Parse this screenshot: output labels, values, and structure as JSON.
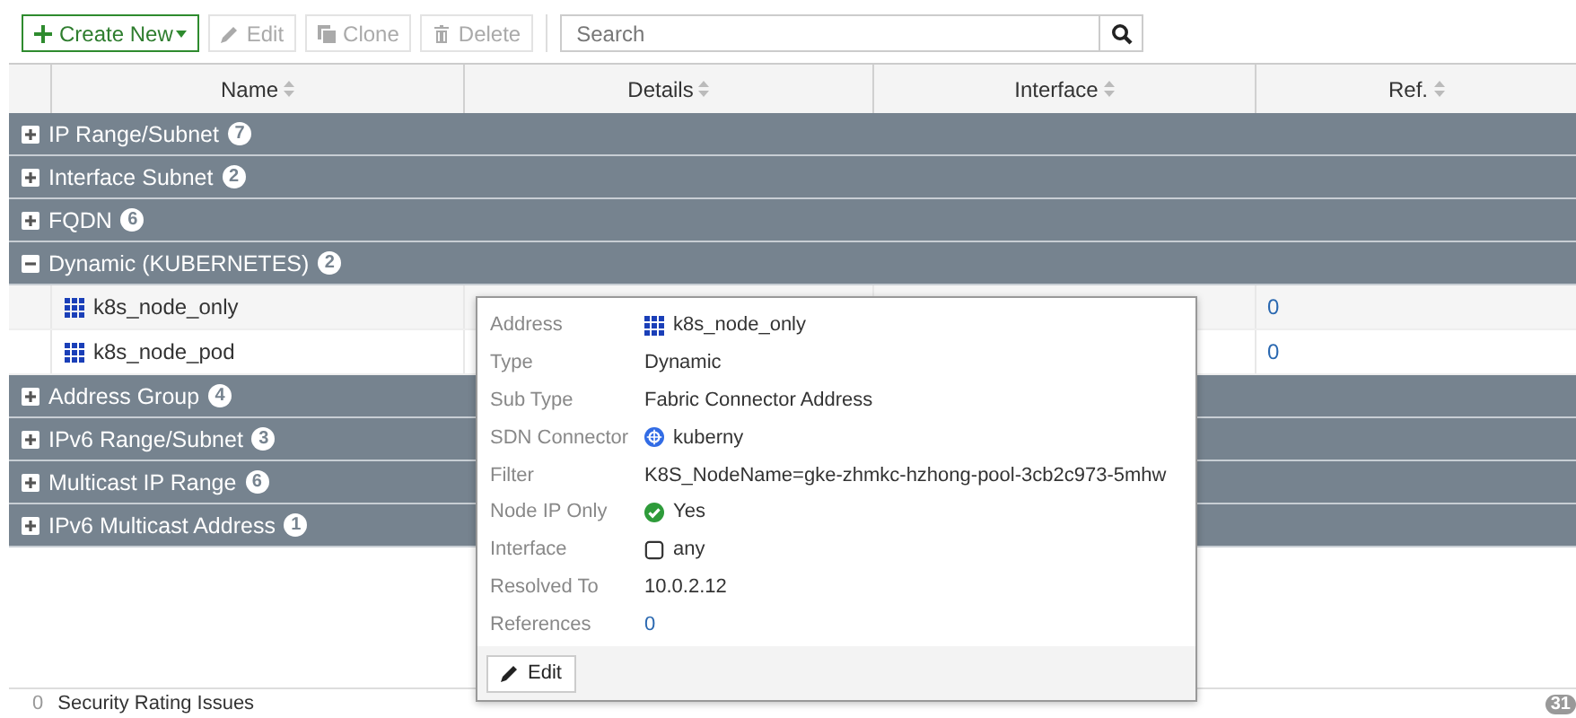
{
  "toolbar": {
    "buttons": [
      {
        "label": "Create New",
        "kind": "create",
        "disabled": false
      },
      {
        "label": "Edit",
        "kind": "edit",
        "disabled": true
      },
      {
        "label": "Clone",
        "kind": "clone",
        "disabled": true
      },
      {
        "label": "Delete",
        "kind": "delete",
        "disabled": true
      }
    ],
    "search": {
      "placeholder": "Search"
    }
  },
  "table": {
    "columns": [
      "Name",
      "Details",
      "Interface",
      "Ref."
    ],
    "groups": [
      {
        "label": "IP Range/Subnet",
        "count": "7",
        "expanded": false
      },
      {
        "label": "Interface Subnet",
        "count": "2",
        "expanded": false
      },
      {
        "label": "FQDN",
        "count": "6",
        "expanded": false
      },
      {
        "label": "Dynamic (KUBERNETES)",
        "count": "2",
        "expanded": true,
        "children": [
          {
            "name": "k8s_node_only",
            "ref": "0"
          },
          {
            "name": "k8s_node_pod",
            "ref": "0"
          }
        ]
      },
      {
        "label": "Address Group",
        "count": "4",
        "expanded": false
      },
      {
        "label": "IPv6 Range/Subnet",
        "count": "3",
        "expanded": false
      },
      {
        "label": "Multicast IP Range",
        "count": "6",
        "expanded": false
      },
      {
        "label": "IPv6 Multicast Address",
        "count": "1",
        "expanded": false
      }
    ]
  },
  "popover": {
    "fields": [
      {
        "label": "Address",
        "value": "k8s_node_only",
        "kind": "address"
      },
      {
        "label": "Type",
        "value": "Dynamic",
        "kind": "text"
      },
      {
        "label": "Sub Type",
        "value": "Fabric Connector Address",
        "kind": "text"
      },
      {
        "label": "SDN Connector",
        "value": "kuberny",
        "kind": "connector"
      },
      {
        "label": "Filter",
        "value": "K8S_NodeName=gke-zhmkc-hzhong-pool-3cb2c973-5mhw",
        "kind": "text"
      },
      {
        "label": "Node IP Only",
        "value": "Yes",
        "kind": "check"
      },
      {
        "label": "Interface",
        "value": "any",
        "kind": "interface"
      },
      {
        "label": "Resolved To",
        "value": "10.0.2.12",
        "kind": "text"
      },
      {
        "label": "References",
        "value": "0",
        "kind": "link"
      }
    ],
    "button": "Edit"
  },
  "footer": {
    "count": "0",
    "label": "Security Rating Issues",
    "badge": "31"
  }
}
